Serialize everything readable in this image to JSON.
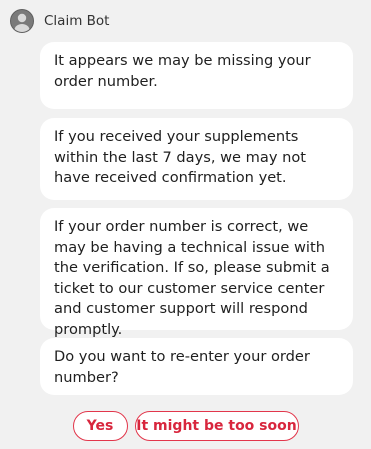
{
  "bot": {
    "name": "Claim Bot",
    "avatar_icon": "user-avatar-icon"
  },
  "messages": [
    {
      "text": "It appears we may be missing your order number."
    },
    {
      "text": "If you received your supplements within the last 7 days, we may not have received confirmation yet."
    },
    {
      "text": "If your order number is correct, we may be having a technical issue with the verification. If so, please submit a ticket to our customer service center and customer support will respond promptly."
    },
    {
      "text": "Do you want to re-enter your order number?"
    }
  ],
  "quick_replies": [
    {
      "label": "Yes"
    },
    {
      "label": "It might be too soon"
    }
  ],
  "colors": {
    "background": "#f1f1f1",
    "bubble": "#ffffff",
    "accent": "#e2364b"
  }
}
